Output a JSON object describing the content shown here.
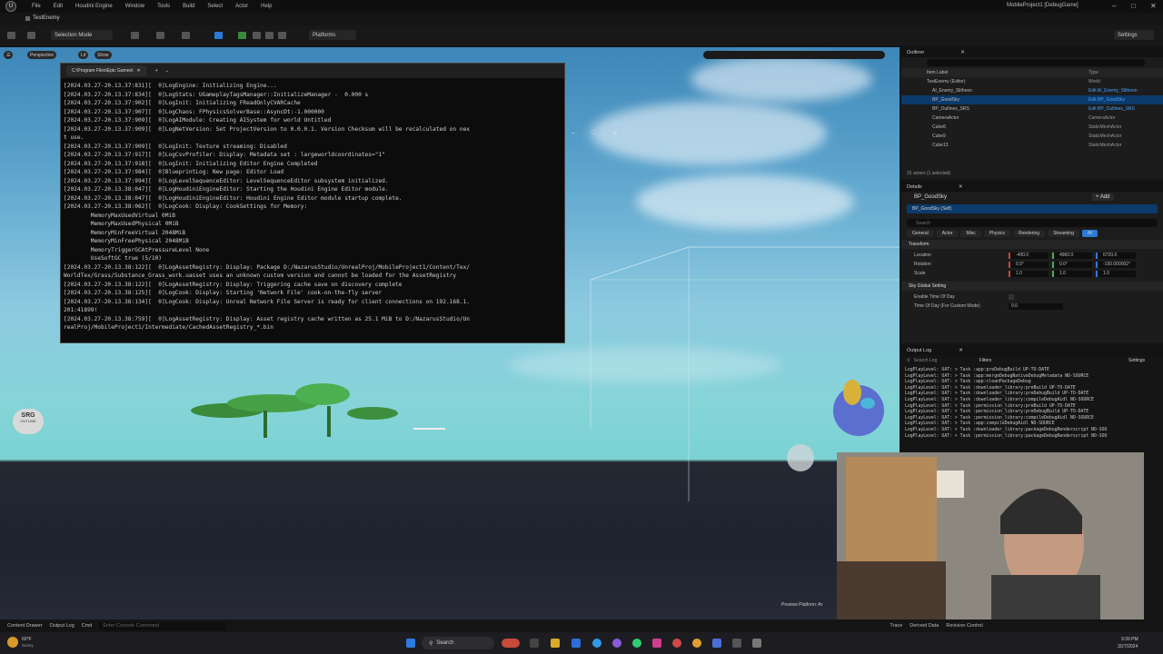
{
  "menu": {
    "items": [
      "File",
      "Edit",
      "Window",
      "Tools",
      "Build",
      "Select",
      "Actor",
      "Help"
    ],
    "extra": "Houdini Engine",
    "window_title": "MobileProject1 [DebugGame]",
    "logo": "U"
  },
  "project_tab": "TestEnemy",
  "toolbar": {
    "selection_mode": "Selection Mode",
    "platforms": "Platforms",
    "settings": "Settings"
  },
  "viewport": {
    "perspective": "Perspective",
    "lit": "Lit",
    "show": "Show",
    "preview": "Preview Platform: Ar",
    "badge": "SRG",
    "badge_sub": "OUTLINE"
  },
  "console": {
    "title": "C:\\Program Files\\Epic Games\\",
    "lines": [
      "[2024.03.27-20.13.37:831][  0]LogEngine: Initializing Engine...",
      "[2024.03.27-20.13.37:834][  0]LogStats: UGameplayTagsManager::InitializeManager -  0.000 s",
      "[2024.03.27-20.13.37:902][  0]LogInit: Initializing FReadOnlyCVARCache",
      "[2024.03.27-20.13.37:907][  0]LogChaos: FPhysicsSolverBase::AsyncDt:-1.000000",
      "[2024.03.27-20.13.37:909][  0]LogAIModule: Creating AISystem for world Untitled",
      "[2024.03.27-20.13.37:909][  0]LogNetVersion: Set ProjectVersion to 0.0.0.1. Version Checksum will be recalculated on nex",
      "t use.",
      "[2024.03.27-20.13.37:909][  0]LogInit: Texture streaming: Disabled",
      "[2024.03.27-20.13.37:917][  0]LogCsvProfiler: Display: Metadata set : largeworldcoordinates=\"1\"",
      "[2024.03.27-20.13.37:918][  0]LogInit: Initializing Editor Engine Completed",
      "[2024.03.27-20.13.37:984][  0]BlueprintLog: New page: Editor Load",
      "[2024.03.27-20.13.37:994][  0]LogLevelSequenceEditor: LevelSequenceEditor subsystem initialized.",
      "[2024.03.27-20.13.38:047][  0]LogHoudiniEngineEditor: Starting the Houdini Engine Editor module.",
      "[2024.03.27-20.13.38:047][  0]LogHoudiniEngineEditor: Houdini Engine Editor module startup complete.",
      "[2024.03.27-20.13.38:062][  0]LogCook: Display: CookSettings for Memory:",
      "        MemoryMaxUsedVirtual 0MiB",
      "        MemoryMaxUsedPhysical 0MiB",
      "        MemoryMinFreeVirtual 2048MiB",
      "        MemoryMinFreePhysical 2048MiB",
      "        MemoryTriggerGCAtPressureLevel None",
      "        UseSoftGC true (5/10)",
      "[2024.03.27-20.13.38:122][  0]LogAssetRegistry: Display: Package D:/NazarusStudio/UnrealProj/MobileProject1/Content/Tex/",
      "WorldTex/Grass/Substance_Grass_work.uasset uses an unknown custom version and cannot be loaded for the AssetRegistry",
      "[2024.03.27-20.13.38:122][  0]LogAssetRegistry: Display: Triggering cache save on discovery complete",
      "[2024.03.27-20.13.38:125][  0]LogCook: Display: Starting 'Network File' cook-on-the-fly server",
      "[2024.03.27-20.13.38:134][  0]LogCook: Display: Unreal Network File Server is ready for client connections on 192.168.1.",
      "201:41899!",
      "[2024.03.27-20.13.38:759][  0]LogAssetRegistry: Display: Asset registry cache written as 25.1 MiB to D:/NazarusStudio/Un",
      "realProj/MobileProject1/Intermediate/CachedAssetRegistry_*.bin"
    ]
  },
  "outliner": {
    "title": "Outliner",
    "col_label": "Item Label",
    "col_type": "Type",
    "items": [
      {
        "label": "TestEnemy (Editor)",
        "type": "World"
      },
      {
        "label": "AI_Enemy_Slitheon",
        "type": "Edit AI_Enemy_Slitheon"
      },
      {
        "label": "BP_GoodSky",
        "type": "Edit BP_GoodSky"
      },
      {
        "label": "BP_Outlines_SRS",
        "type": "Edit BP_Outlines_SRS"
      },
      {
        "label": "CameraActor",
        "type": "CameraActor"
      },
      {
        "label": "Cube8",
        "type": "StaticMeshActor"
      },
      {
        "label": "Cube9",
        "type": "StaticMeshActor"
      },
      {
        "label": "Cube13",
        "type": "StaticMeshActor"
      }
    ],
    "footer": "31 actors (1 selected)"
  },
  "details": {
    "title": "Details",
    "actor": "BP_GoodSky",
    "self": "BP_GoodSky (Self)",
    "add": "+ Add",
    "search": "Search",
    "tabs": [
      "General",
      "Actor",
      "Misc",
      "Physics",
      "Rendering",
      "Streaming",
      "All"
    ],
    "transform": "Transform",
    "location": [
      "-400.0",
      "4960.0",
      "6720.0"
    ],
    "rotation": [
      "0.0°",
      "0.0°",
      "-150.000002°"
    ],
    "scale": [
      "1.0",
      "1.0",
      "1.0"
    ],
    "labels": [
      "Location",
      "Rotation",
      "Scale"
    ],
    "sky_section": "Sky Global Setting",
    "enable_time": "Enable Time Of Day",
    "time_custom": "Time Of Day (For Custom Mode)",
    "time_val": "9.0"
  },
  "output_log": {
    "title": "Output Log",
    "search": "Search Log",
    "filters": "Filters",
    "settings": "Settings",
    "lines": [
      "LogPlayLevel: UAT: > Task :app:preDebugBuild UP-TO-DATE",
      "LogPlayLevel: UAT: > Task :app:mergeDebugNativeDebugMetadata NO-SOURCE",
      "LogPlayLevel: UAT: > Task :app:cleanPackageDebug",
      "LogPlayLevel: UAT: > Task :downloader_library:preBuild UP-TO-DATE",
      "LogPlayLevel: UAT: > Task :downloader_library:preDebugBuild UP-TO-DATE",
      "LogPlayLevel: UAT: > Task :downloader_library:compileDebugAidl NO-SOURCE",
      "LogPlayLevel: UAT: > Task :permission_library:preBuild UP-TO-DATE",
      "LogPlayLevel: UAT: > Task :permission_library:preDebugBuild UP-TO-DATE",
      "LogPlayLevel: UAT: > Task :permission_library:compileDebugAidl NO-SOURCE",
      "LogPlayLevel: UAT: > Task :app:compileDebugAidl NO-SOURCE",
      "LogPlayLevel: UAT: > Task :downloader_library:packageDebugRenderscript NO-SOU",
      "LogPlayLevel: UAT: > Task :permission_library:packageDebugRenderscript NO-SOU"
    ]
  },
  "statusbar": {
    "content_drawer": "Content Drawer",
    "output_log": "Output Log",
    "cmd": "Cmd",
    "cmd_placeholder": "Enter Console Command",
    "trace": "Trace",
    "derived": "Derived Data",
    "revision": "Revision Control"
  },
  "taskbar": {
    "weather": "60°F",
    "weather_sub": "Sunny",
    "search": "Search",
    "time": "9:39 PM",
    "date": "3/27/2024"
  }
}
